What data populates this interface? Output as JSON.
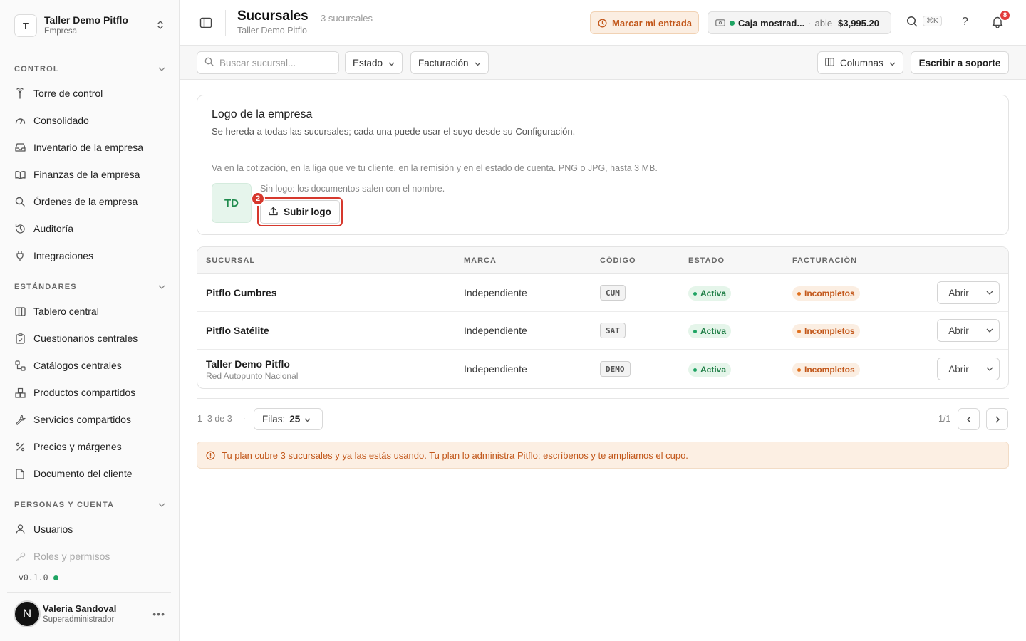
{
  "org": {
    "initial": "T",
    "name": "Taller Demo Pitflo",
    "type": "Empresa"
  },
  "sidebar": {
    "sections": [
      {
        "title": "CONTROL",
        "items": [
          {
            "label": "Torre de control",
            "icon": "tower-icon"
          },
          {
            "label": "Consolidado",
            "icon": "gauge-icon"
          },
          {
            "label": "Inventario de la empresa",
            "icon": "inbox-icon"
          },
          {
            "label": "Finanzas de la empresa",
            "icon": "book-icon"
          },
          {
            "label": "Órdenes de la empresa",
            "icon": "search-icon"
          },
          {
            "label": "Auditoría",
            "icon": "history-icon"
          },
          {
            "label": "Integraciones",
            "icon": "plug-icon"
          }
        ]
      },
      {
        "title": "ESTÁNDARES",
        "items": [
          {
            "label": "Tablero central",
            "icon": "columns-icon"
          },
          {
            "label": "Cuestionarios centrales",
            "icon": "clipboard-icon"
          },
          {
            "label": "Catálogos centrales",
            "icon": "workflow-icon"
          },
          {
            "label": "Productos compartidos",
            "icon": "boxes-icon"
          },
          {
            "label": "Servicios compartidos",
            "icon": "wrench-icon"
          },
          {
            "label": "Precios y márgenes",
            "icon": "percent-icon"
          },
          {
            "label": "Documento del cliente",
            "icon": "file-icon"
          }
        ]
      },
      {
        "title": "PERSONAS Y CUENTA",
        "items": [
          {
            "label": "Usuarios",
            "icon": "user-icon"
          },
          {
            "label": "Roles y permisos",
            "icon": "key-icon"
          }
        ]
      }
    ],
    "version": "v0.1.0"
  },
  "user": {
    "initial": "N",
    "name": "Valeria Sandoval",
    "role": "Superadministrador"
  },
  "header": {
    "title": "Sucursales",
    "count": "3 sucursales",
    "subtitle": "Taller Demo Pitflo",
    "clock_label": "Marcar mi entrada",
    "cash_name": "Caja mostrad...",
    "cash_sep": "·",
    "cash_state": "abie",
    "cash_amount": "$3,995.20",
    "shortcut": "⌘K",
    "help": "?",
    "notifications": "8"
  },
  "toolbar": {
    "search_placeholder": "Buscar sucursal...",
    "filter_estado": "Estado",
    "filter_facturacion": "Facturación",
    "columns": "Columnas",
    "support": "Escribir a soporte"
  },
  "logo_card": {
    "title": "Logo de la empresa",
    "description": "Se hereda a todas las sucursales; cada una puede usar el suyo desde su Configuración.",
    "note": "Va en la cotización, en la liga que ve tu cliente, en la remisión y en el estado de cuenta. PNG o JPG, hasta 3 MB.",
    "initials": "TD",
    "no_logo": "Sin logo: los documentos salen con el nombre.",
    "upload": "Subir logo",
    "step": "2"
  },
  "table": {
    "headers": [
      "SUCURSAL",
      "MARCA",
      "CÓDIGO",
      "ESTADO",
      "FACTURACIÓN"
    ],
    "rows": [
      {
        "name": "Pitflo Cumbres",
        "sub": "",
        "brand": "Independiente",
        "code": "CUM",
        "status": "Activa",
        "billing": "Incompletos",
        "action": "Abrir"
      },
      {
        "name": "Pitflo Satélite",
        "sub": "",
        "brand": "Independiente",
        "code": "SAT",
        "status": "Activa",
        "billing": "Incompletos",
        "action": "Abrir"
      },
      {
        "name": "Taller Demo Pitflo",
        "sub": "Red Autopunto Nacional",
        "brand": "Independiente",
        "code": "DEMO",
        "status": "Activa",
        "billing": "Incompletos",
        "action": "Abrir"
      }
    ]
  },
  "pagination": {
    "range": "1–3 de 3",
    "dot": "·",
    "rows_label": "Filas:",
    "rows_value": "25",
    "page": "1/1"
  },
  "alert": "Tu plan cubre 3 sucursales y ya las estás usando. Tu plan lo administra Pitflo: escríbenos y te ampliamos el cupo.",
  "colors": {
    "accent_orange": "#c2571a",
    "success_green": "#1fa463",
    "danger_red": "#d6382d"
  }
}
